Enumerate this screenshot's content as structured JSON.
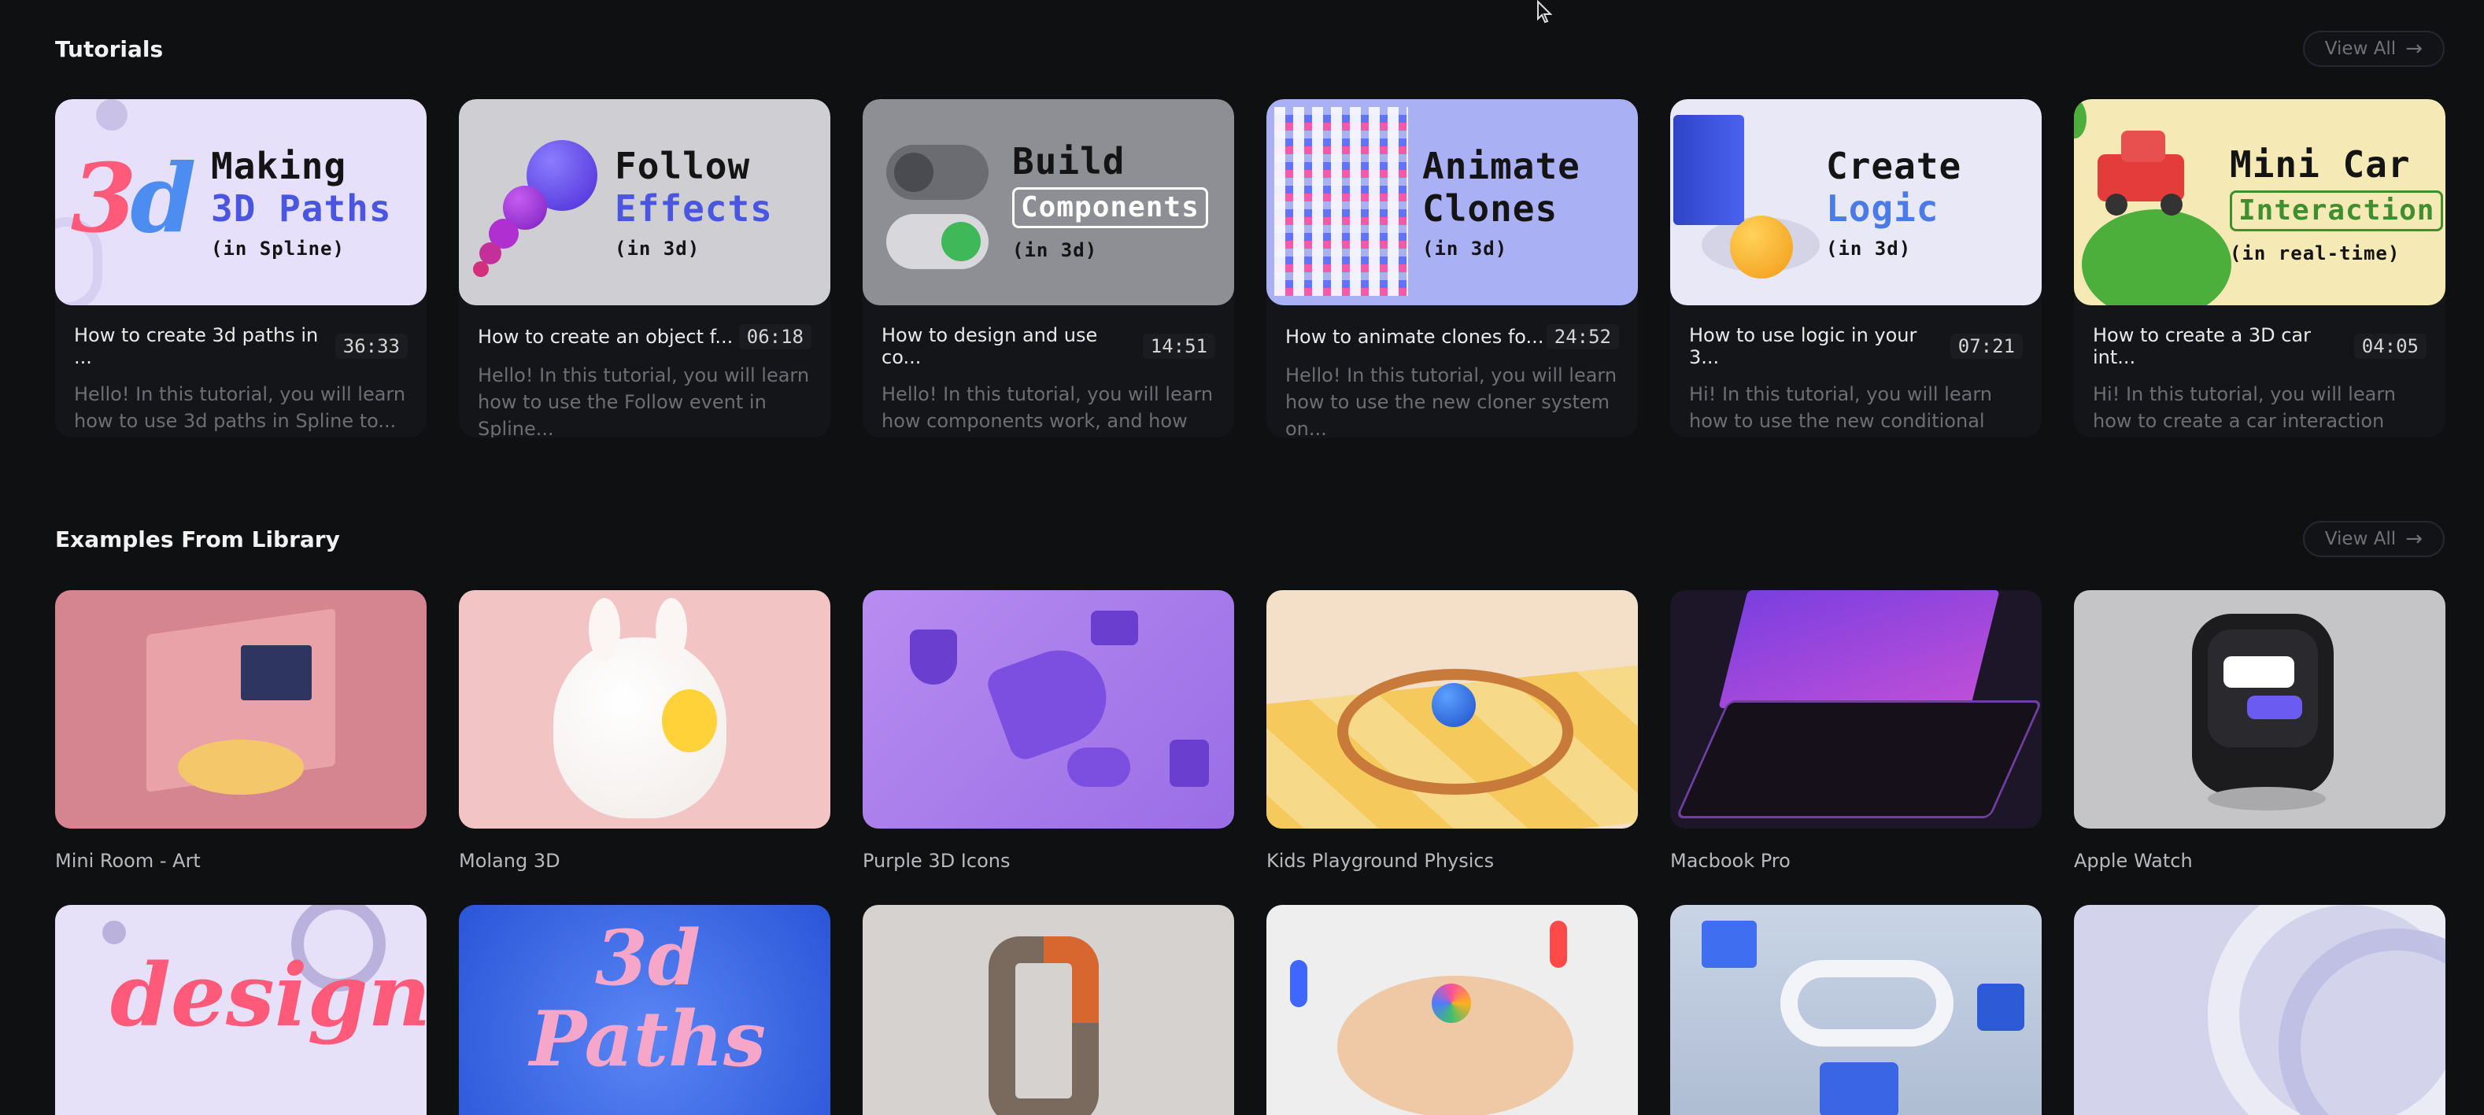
{
  "tutorials": {
    "title": "Tutorials",
    "view_all": "View All",
    "items": [
      {
        "line1": "Making",
        "line2": "3D Paths",
        "line3": "(in Spline)",
        "name": "How to create 3d paths in ...",
        "duration": "36:33",
        "desc": "Hello! In this tutorial, you will learn how to use 3d paths in Spline to..."
      },
      {
        "line1": "Follow",
        "line2": "Effects",
        "line3": "(in 3d)",
        "name": "How to create an object f...",
        "duration": "06:18",
        "desc": "Hello! In this tutorial, you will learn how to use the Follow event in Spline..."
      },
      {
        "line1": "Build",
        "line2": "Components",
        "line3": "(in 3d)",
        "name": "How to design and use co...",
        "duration": "14:51",
        "desc": "Hello! In this tutorial, you will learn how components work, and how the..."
      },
      {
        "line1": "Animate",
        "line2": "Clones",
        "line3": "(in 3d)",
        "name": "How to animate clones fo...",
        "duration": "24:52",
        "desc": "Hello! In this tutorial, you will learn how to use the new cloner system on..."
      },
      {
        "line1": "Create",
        "line2": "Logic",
        "line3": "(in 3d)",
        "name": "How to use logic in your 3...",
        "duration": "07:21",
        "desc": "Hi! In this tutorial, you will learn how to use the new conditional logic event i..."
      },
      {
        "line1": "Mini Car",
        "line2": "Interaction",
        "line3": "(in real-time)",
        "name": "How to create a 3D car int...",
        "duration": "04:05",
        "desc": "Hi! In this tutorial, you will learn how to create a car interaction using the..."
      }
    ]
  },
  "library": {
    "title": "Examples From Library",
    "view_all": "View All",
    "items": [
      {
        "name": "Mini Room - Art"
      },
      {
        "name": "Molang 3D"
      },
      {
        "name": "Purple 3D Icons"
      },
      {
        "name": "Kids Playground Physics"
      },
      {
        "name": "Macbook Pro"
      },
      {
        "name": "Apple Watch"
      }
    ],
    "row2": [
      {
        "art": "design"
      },
      {
        "art_line1": "3d",
        "art_line2": "Paths"
      },
      {},
      {},
      {},
      {}
    ]
  },
  "colors": {
    "background": "#0f1012",
    "accent_blue": "#4a55e0",
    "accent_green": "#3f8f2e"
  }
}
